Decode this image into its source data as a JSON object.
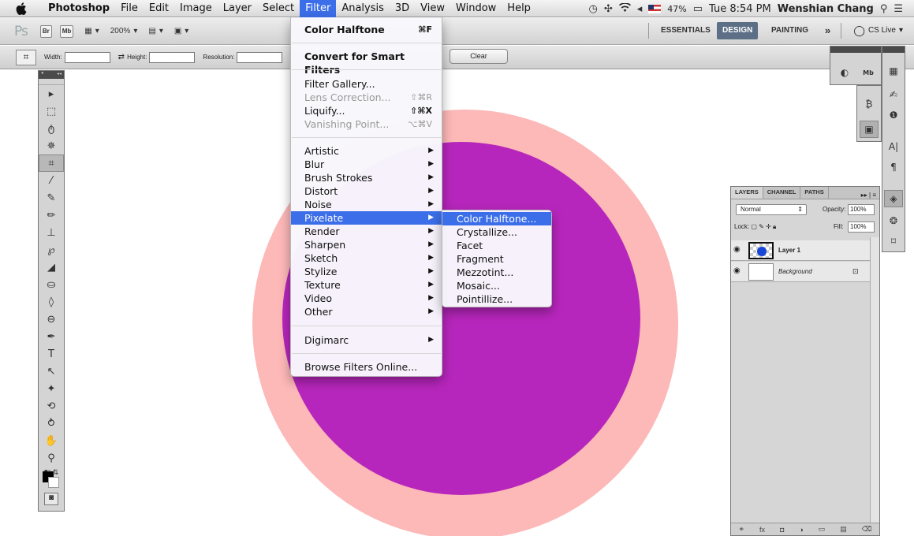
{
  "menubar": {
    "app": "Photoshop",
    "items": [
      "File",
      "Edit",
      "Image",
      "Layer",
      "Select",
      "Filter",
      "Analysis",
      "3D",
      "View",
      "Window",
      "Help"
    ],
    "active": "Filter",
    "battery": "47%",
    "clock": "Tue 8:54 PM",
    "user": "Wenshian Chang"
  },
  "appbar": {
    "logo": "Ps",
    "br": "Br",
    "mb": "Mb",
    "zoom": "200%",
    "workspaces": [
      "ESSENTIALS",
      "DESIGN",
      "PAINTING"
    ],
    "active_workspace": "DESIGN",
    "more": "»",
    "cslive": "CS Live"
  },
  "options": {
    "width_label": "Width:",
    "height_label": "Height:",
    "resolution_label": "Resolution:",
    "clear": "Clear"
  },
  "filter_menu": {
    "items": [
      {
        "label": "Color Halftone",
        "shortcut": "⌘F",
        "bold": true
      },
      {
        "label": "Convert for Smart Filters"
      },
      {
        "label": "Filter Gallery..."
      },
      {
        "label": "Lens Correction...",
        "shortcut": "⇧⌘R",
        "disabled": true
      },
      {
        "label": "Liquify...",
        "shortcut": "⇧⌘X"
      },
      {
        "label": "Vanishing Point...",
        "shortcut": "⌥⌘V",
        "disabled": true
      },
      {
        "label": "Artistic"
      },
      {
        "label": "Blur"
      },
      {
        "label": "Brush Strokes"
      },
      {
        "label": "Distort"
      },
      {
        "label": "Noise"
      },
      {
        "label": "Pixelate",
        "highlighted": true
      },
      {
        "label": "Render"
      },
      {
        "label": "Sharpen"
      },
      {
        "label": "Sketch"
      },
      {
        "label": "Stylize"
      },
      {
        "label": "Texture"
      },
      {
        "label": "Video"
      },
      {
        "label": "Other"
      },
      {
        "label": "Digimarc"
      },
      {
        "label": "Browse Filters Online..."
      }
    ]
  },
  "pixelate_submenu": {
    "items": [
      "Color Halftone...",
      "Crystallize...",
      "Facet",
      "Fragment",
      "Mezzotint...",
      "Mosaic...",
      "Pointillize..."
    ],
    "highlighted": "Color Halftone..."
  },
  "layers_panel": {
    "tabs": [
      "LAYERS",
      "CHANNEL",
      "PATHS"
    ],
    "blend_mode": "Normal",
    "opacity_label": "Opacity:",
    "opacity": "100%",
    "lock_label": "Lock:",
    "fill_label": "Fill:",
    "fill": "100%",
    "layers": [
      {
        "name": "Layer 1",
        "selected": true
      },
      {
        "name": "Background",
        "locked": true
      }
    ]
  },
  "colors": {
    "outer_circle": "#fdb8b8",
    "inner_circle": "#b726bc",
    "highlight": "#3b6ee8"
  }
}
